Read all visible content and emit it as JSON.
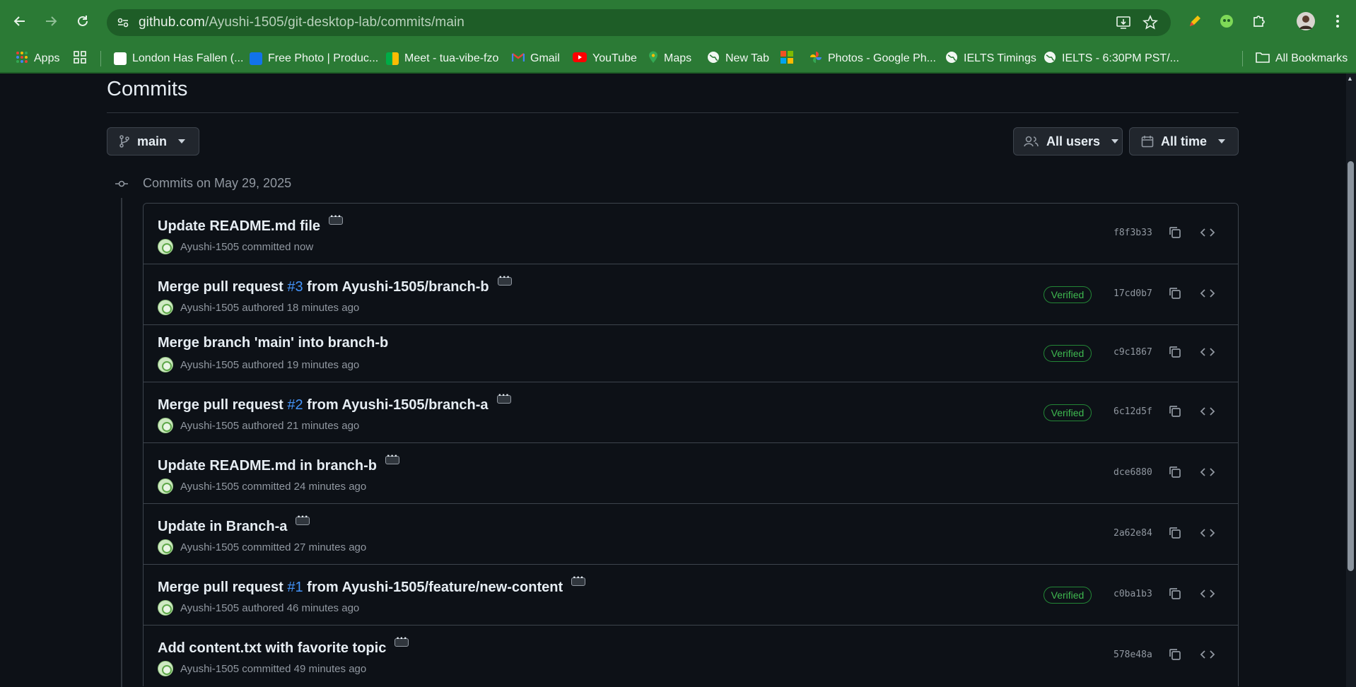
{
  "browser": {
    "url_host": "github.com",
    "url_path": "/Ayushi-1505/git-desktop-lab/commits/main",
    "bookmarks": [
      {
        "label": "Apps",
        "icon": "apps-grid-icon",
        "color": "#e94235"
      },
      {
        "label": "",
        "icon": "grid-icon",
        "color": "#ffffff"
      },
      {
        "label": "London Has Fallen (...",
        "icon": "page-icon",
        "color": "#ffffff"
      },
      {
        "label": "Free Photo | Produc...",
        "icon": "freepik-icon",
        "color": "#1273eb"
      },
      {
        "label": "Meet - tua-vibe-fzo",
        "icon": "meet-icon",
        "color": "#00ac47"
      },
      {
        "label": "Gmail",
        "icon": "gmail-icon",
        "color": "#ea4335"
      },
      {
        "label": "YouTube",
        "icon": "youtube-icon",
        "color": "#ff0000"
      },
      {
        "label": "Maps",
        "icon": "maps-icon",
        "color": "#34a853"
      },
      {
        "label": "New Tab",
        "icon": "globe-icon",
        "color": "#ffffff"
      },
      {
        "label": "",
        "icon": "microsoft-icon",
        "color": "#f25022"
      },
      {
        "label": "Photos - Google Ph...",
        "icon": "photos-icon",
        "color": "#fbbc04"
      },
      {
        "label": "IELTS Timings",
        "icon": "globe-icon",
        "color": "#ffffff"
      },
      {
        "label": "IELTS - 6:30PM PST/...",
        "icon": "globe-icon",
        "color": "#ffffff"
      }
    ],
    "all_bookmarks": "All Bookmarks"
  },
  "page": {
    "title": "Commits",
    "branch_button": "main",
    "users_button": "All users",
    "time_button": "All time",
    "day_label": "Commits on May 29, 2025"
  },
  "commits": [
    {
      "pre": "Update README.md file",
      "pr": "",
      "post": "",
      "author": "Ayushi-1505",
      "action": "committed now",
      "verified": "",
      "sha": "f8f3b33"
    },
    {
      "pre": "Merge pull request ",
      "pr": "#3",
      "post": " from Ayushi-1505/branch-b",
      "author": "Ayushi-1505",
      "action": "authored 18 minutes ago",
      "verified": "Verified",
      "sha": "17cd0b7"
    },
    {
      "pre": "Merge branch 'main' into branch-b",
      "pr": "",
      "post": "",
      "author": "Ayushi-1505",
      "action": "authored 19 minutes ago",
      "verified": "Verified",
      "sha": "c9c1867"
    },
    {
      "pre": "Merge pull request ",
      "pr": "#2",
      "post": " from Ayushi-1505/branch-a",
      "author": "Ayushi-1505",
      "action": "authored 21 minutes ago",
      "verified": "Verified",
      "sha": "6c12d5f"
    },
    {
      "pre": "Update README.md in branch-b",
      "pr": "",
      "post": "",
      "author": "Ayushi-1505",
      "action": "committed 24 minutes ago",
      "verified": "",
      "sha": "dce6880"
    },
    {
      "pre": "Update in Branch-a",
      "pr": "",
      "post": "",
      "author": "Ayushi-1505",
      "action": "committed 27 minutes ago",
      "verified": "",
      "sha": "2a62e84"
    },
    {
      "pre": "Merge pull request ",
      "pr": "#1",
      "post": " from Ayushi-1505/feature/new-content",
      "author": "Ayushi-1505",
      "action": "authored 46 minutes ago",
      "verified": "Verified",
      "sha": "c0ba1b3"
    },
    {
      "pre": "Add content.txt with favorite topic",
      "pr": "",
      "post": "",
      "author": "Ayushi-1505",
      "action": "committed 49 minutes ago",
      "verified": "",
      "sha": "578e48a"
    }
  ]
}
